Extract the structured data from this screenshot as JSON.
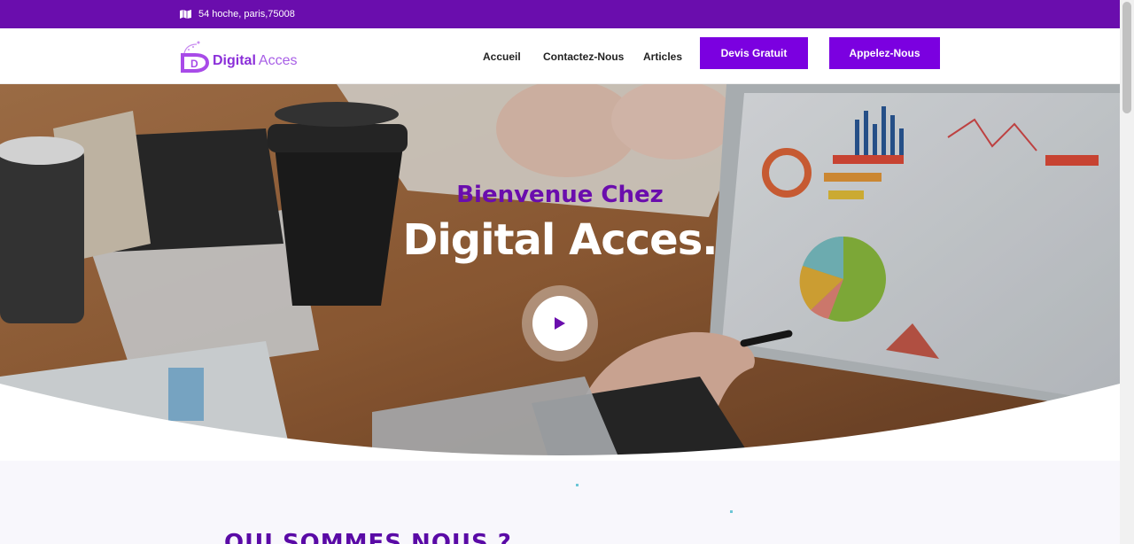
{
  "topbar": {
    "address": "54 hoche, paris,75008",
    "icon": "map-icon"
  },
  "header": {
    "logo": {
      "brand_bold": "Digital",
      "brand_light": "Acces"
    },
    "nav": [
      {
        "label": "Accueil"
      },
      {
        "label": "Contactez-Nous"
      },
      {
        "label": "Articles"
      }
    ],
    "buttons": {
      "devis": "Devis Gratuit",
      "appel": "Appelez-Nous"
    }
  },
  "hero": {
    "subtitle": "Bienvenue Chez",
    "title": "Digital Acces.",
    "play_icon": "play-icon"
  },
  "section": {
    "title": "QUI SOMMES NOUS ?"
  },
  "colors": {
    "primary": "#6a0dad",
    "button": "#7b00e0",
    "heading": "#5a0aa6"
  }
}
